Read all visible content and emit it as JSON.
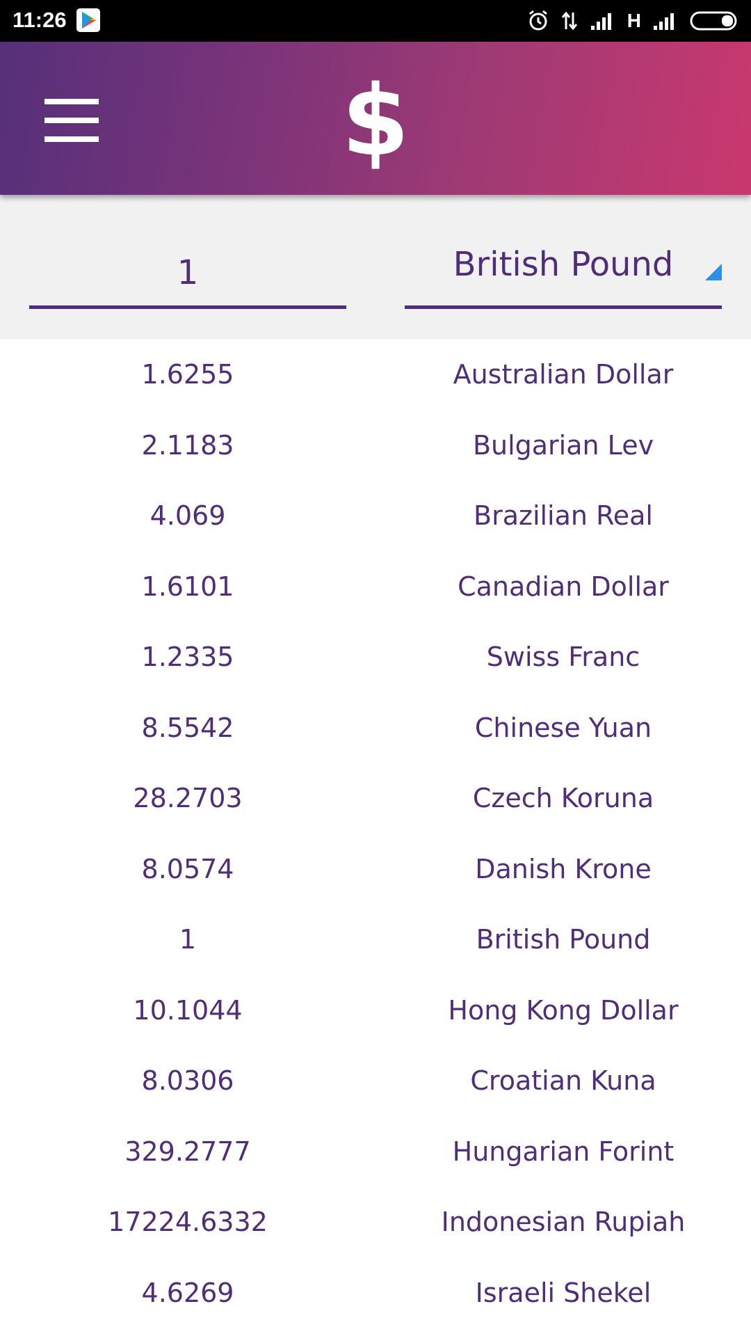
{
  "status_bar": {
    "time": "11:26",
    "network_label": "H"
  },
  "icons": [
    "google-play-icon",
    "alarm-icon",
    "data-arrows-icon",
    "signal-icon",
    "signal-icon",
    "battery-icon",
    "menu-icon",
    "dollar-icon",
    "dropdown-arrow-icon"
  ],
  "app_bar": {
    "logo_symbol": "$"
  },
  "converter": {
    "amount": "1",
    "selected_currency": "British Pound"
  },
  "colors": {
    "text_purple": "#4f2d78",
    "gradient_start": "#55307a",
    "gradient_end": "#c9386e",
    "dropdown_accent": "#2f8ee6"
  },
  "rates": [
    {
      "value": "1.6255",
      "currency": "Australian Dollar"
    },
    {
      "value": "2.1183",
      "currency": "Bulgarian Lev"
    },
    {
      "value": "4.069",
      "currency": "Brazilian Real"
    },
    {
      "value": "1.6101",
      "currency": "Canadian Dollar"
    },
    {
      "value": "1.2335",
      "currency": "Swiss Franc"
    },
    {
      "value": "8.5542",
      "currency": "Chinese Yuan"
    },
    {
      "value": "28.2703",
      "currency": "Czech Koruna"
    },
    {
      "value": "8.0574",
      "currency": "Danish Krone"
    },
    {
      "value": "1",
      "currency": "British Pound"
    },
    {
      "value": "10.1044",
      "currency": "Hong Kong Dollar"
    },
    {
      "value": "8.0306",
      "currency": "Croatian Kuna"
    },
    {
      "value": "329.2777",
      "currency": "Hungarian Forint"
    },
    {
      "value": "17224.6332",
      "currency": "Indonesian Rupiah"
    },
    {
      "value": "4.6269",
      "currency": "Israeli Shekel"
    }
  ]
}
